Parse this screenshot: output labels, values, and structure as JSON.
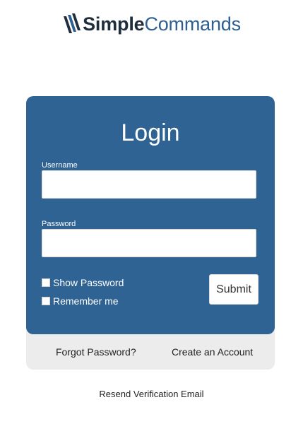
{
  "brand": {
    "name_bold": "Simple",
    "name_light": "Commands",
    "colors": {
      "dark": "#1f2d3d",
      "accent": "#2e5f90",
      "card": "#2f6394"
    }
  },
  "login": {
    "title": "Login",
    "username_label": "Username",
    "username_value": "",
    "password_label": "Password",
    "password_value": "",
    "show_password_label": "Show Password",
    "remember_me_label": "Remember me",
    "submit_label": "Submit"
  },
  "footer": {
    "forgot_password": "Forgot Password?",
    "create_account": "Create an Account"
  },
  "resend_verification": "Resend Verification Email"
}
